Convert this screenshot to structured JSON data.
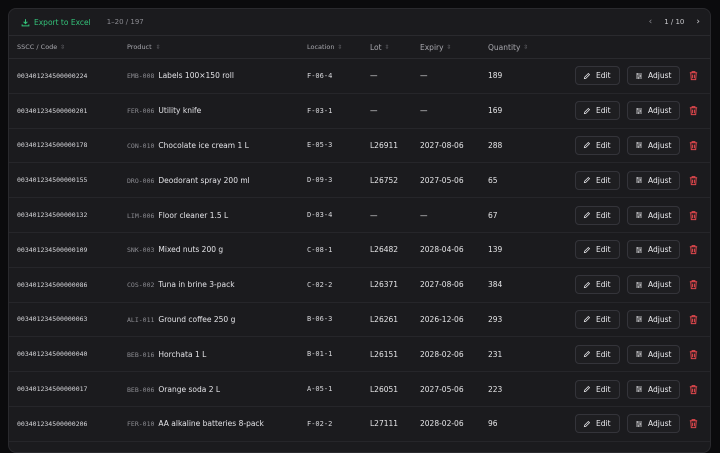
{
  "toolbar": {
    "export_label": "Export to Excel",
    "range": "1–20 / 197",
    "page": "1 / 10"
  },
  "columns": {
    "sscc": "SSCC / Code",
    "product": "Product",
    "location": "Location",
    "lot": "Lot",
    "expiry": "Expiry",
    "quantity": "Quantity"
  },
  "actions": {
    "edit": "Edit",
    "adjust": "Adjust"
  },
  "colors": {
    "accent": "#34c37a",
    "danger": "#e0474c"
  },
  "rows": [
    {
      "sscc": "003401234500000224",
      "code": "EMB-008",
      "name": "Labels 100×150 roll",
      "location": "F-06-4",
      "lot": "—",
      "expiry": "—",
      "quantity": "189"
    },
    {
      "sscc": "003401234500000201",
      "code": "FER-006",
      "name": "Utility knife",
      "location": "F-03-1",
      "lot": "—",
      "expiry": "—",
      "quantity": "169"
    },
    {
      "sscc": "003401234500000178",
      "code": "CON-010",
      "name": "Chocolate ice cream 1 L",
      "location": "E-05-3",
      "lot": "L26911",
      "expiry": "2027-08-06",
      "quantity": "288"
    },
    {
      "sscc": "003401234500000155",
      "code": "DRO-006",
      "name": "Deodorant spray 200 ml",
      "location": "D-09-3",
      "lot": "L26752",
      "expiry": "2027-05-06",
      "quantity": "65"
    },
    {
      "sscc": "003401234500000132",
      "code": "LIM-006",
      "name": "Floor cleaner 1.5 L",
      "location": "D-03-4",
      "lot": "—",
      "expiry": "—",
      "quantity": "67"
    },
    {
      "sscc": "003401234500000109",
      "code": "SNK-003",
      "name": "Mixed nuts 200 g",
      "location": "C-08-1",
      "lot": "L26482",
      "expiry": "2028-04-06",
      "quantity": "139"
    },
    {
      "sscc": "003401234500000086",
      "code": "COS-002",
      "name": "Tuna in brine 3-pack",
      "location": "C-02-2",
      "lot": "L26371",
      "expiry": "2027-08-06",
      "quantity": "384"
    },
    {
      "sscc": "003401234500000063",
      "code": "ALI-011",
      "name": "Ground coffee 250 g",
      "location": "B-06-3",
      "lot": "L26261",
      "expiry": "2026-12-06",
      "quantity": "293"
    },
    {
      "sscc": "003401234500000040",
      "code": "BEB-016",
      "name": "Horchata 1 L",
      "location": "B-01-1",
      "lot": "L26151",
      "expiry": "2028-02-06",
      "quantity": "231"
    },
    {
      "sscc": "003401234500000017",
      "code": "BEB-006",
      "name": "Orange soda 2 L",
      "location": "A-05-1",
      "lot": "L26051",
      "expiry": "2027-05-06",
      "quantity": "223"
    },
    {
      "sscc": "003401234500000206",
      "code": "FER-010",
      "name": "AA alkaline batteries 8-pack",
      "location": "F-02-2",
      "lot": "L27111",
      "expiry": "2028-02-06",
      "quantity": "96"
    }
  ]
}
